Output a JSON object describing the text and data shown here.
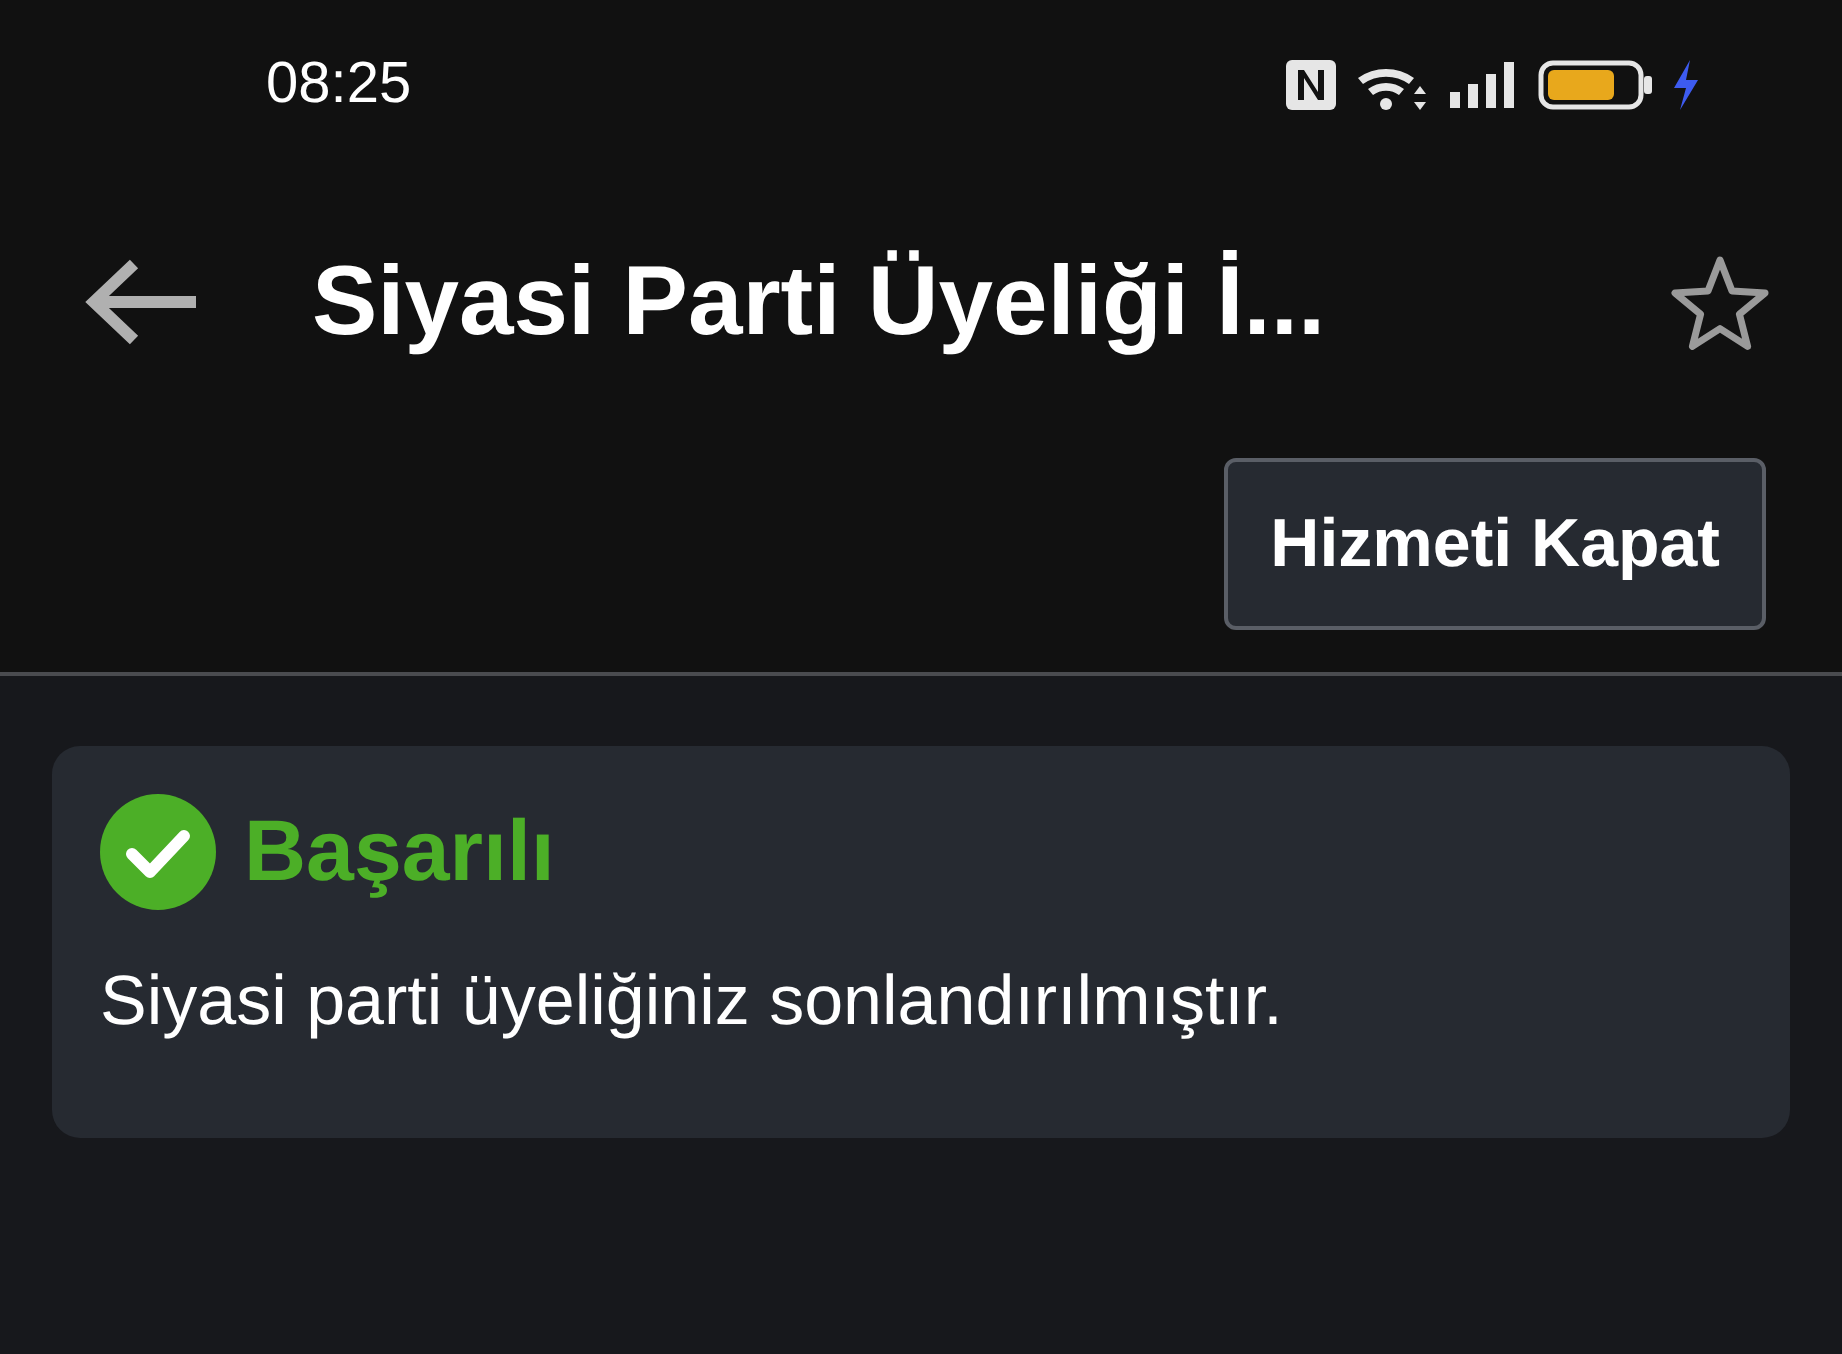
{
  "status_bar": {
    "time": "08:25"
  },
  "header": {
    "title": "Siyasi Parti Üyeliği İ...",
    "favorite": false
  },
  "action_button": {
    "label": "Hizmeti Kapat"
  },
  "result": {
    "kind": "success",
    "title": "Başarılı",
    "message": "Siyasi parti üyeliğiniz sonlandırılmıştır."
  }
}
